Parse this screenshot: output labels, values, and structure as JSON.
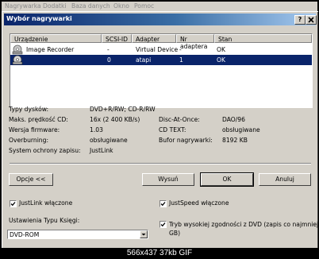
{
  "app_menu": [
    "Nagrywarka",
    "Dodatki",
    "Baza danych",
    "Okno",
    "Pomoc"
  ],
  "dialog": {
    "title": "Wybór nagrywarki",
    "help_label": "?",
    "close_label": "X"
  },
  "device_list": {
    "columns": [
      "Urządzenie",
      "SCSI-ID",
      "Adapter",
      "Nr adaptera",
      "Stan"
    ],
    "rows": [
      {
        "device": "Image Recorder",
        "scsi_id": "-",
        "adapter": "Virtual Device",
        "adapter_no": "-",
        "status": "OK",
        "icon": "image-recorder-icon",
        "selected": false
      },
      {
        "device": "",
        "scsi_id": "0",
        "adapter": "atapi",
        "adapter_no": "1",
        "status": "OK",
        "icon": "cd-drive-icon",
        "selected": true
      }
    ]
  },
  "info": {
    "disc_types_label": "Typy dysków:",
    "disc_types": "DVD+R/RW; CD-R/RW",
    "max_speed_label": "Maks. prędkość CD:",
    "max_speed": "16x (2 400 KB/s)",
    "firmware_label": "Wersja firmware:",
    "firmware": "1.03",
    "overburning_label": "Overburning:",
    "overburning": "obsługiwane",
    "protection_label": "System ochrony zapisu:",
    "protection": "JustLink",
    "dao_label": "Disc-At-Once:",
    "dao": "DAO/96",
    "cdtext_label": "CD TEXT:",
    "cdtext": "obsługiwane",
    "buffer_label": "Bufor nagrywarki:",
    "buffer": "8192 KB"
  },
  "buttons": {
    "options": "Opcje <<",
    "eject": "Wysuń",
    "ok": "OK",
    "cancel": "Anuluj"
  },
  "options": {
    "justlink_label": "JustLink włączone",
    "justlink_checked": true,
    "justspeed_label": "JustSpeed włączone",
    "justspeed_checked": true,
    "compat_label_1": "Tryb wysokiej zgodności z DVD (zapis co najmniej 1",
    "compat_label_2": "GB)",
    "compat_checked": true,
    "book_type_label": "Ustawienia Typu Księgi:",
    "book_type_value": "DVD-ROM"
  },
  "footer": "566x437 37kb GIF",
  "colors": {
    "title_start": "#0a246a",
    "title_end": "#a6caf0",
    "selection": "#0a246a",
    "face": "#d4d0c8"
  }
}
